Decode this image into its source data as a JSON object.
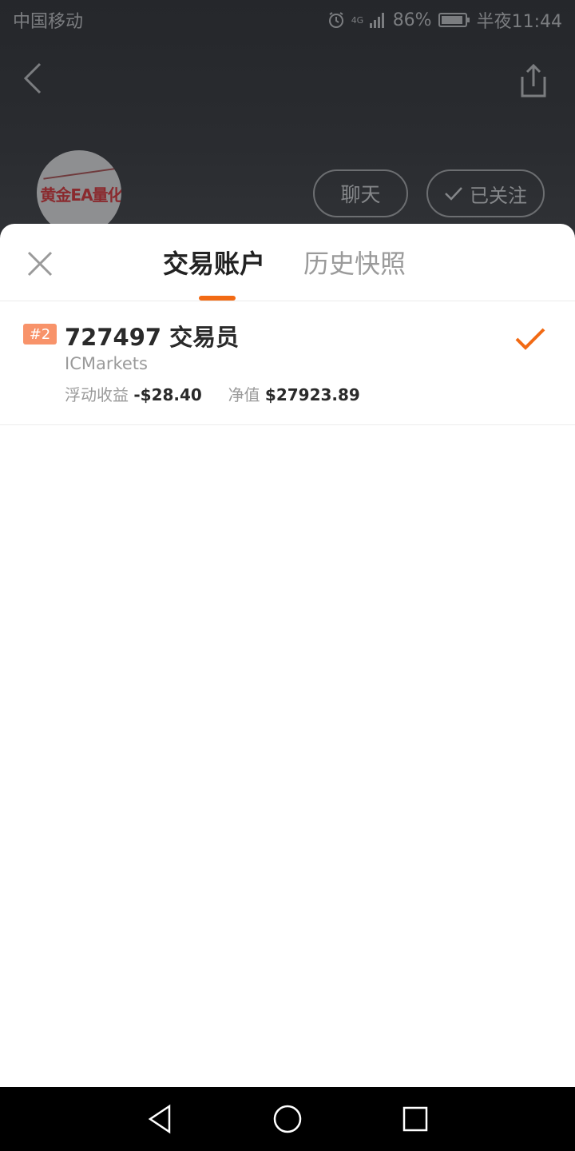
{
  "status_bar": {
    "carrier": "中国移动",
    "network": "4G",
    "battery": "86%",
    "time": "半夜11:44"
  },
  "background_page": {
    "avatar_text": "黄金EA量化",
    "chat_label": "聊天",
    "follow_label": "已关注"
  },
  "sheet": {
    "tabs": [
      {
        "label": "交易账户",
        "active": true
      },
      {
        "label": "历史快照",
        "active": false
      }
    ],
    "accounts": [
      {
        "rank": "#2",
        "title": "727497 交易员",
        "broker": "ICMarkets",
        "floating_label": "浮动收益",
        "floating_value": "-$28.40",
        "equity_label": "净值",
        "equity_value": "$27923.89",
        "selected": true
      }
    ]
  },
  "colors": {
    "accent": "#f26a14",
    "badge": "#f8936a"
  }
}
